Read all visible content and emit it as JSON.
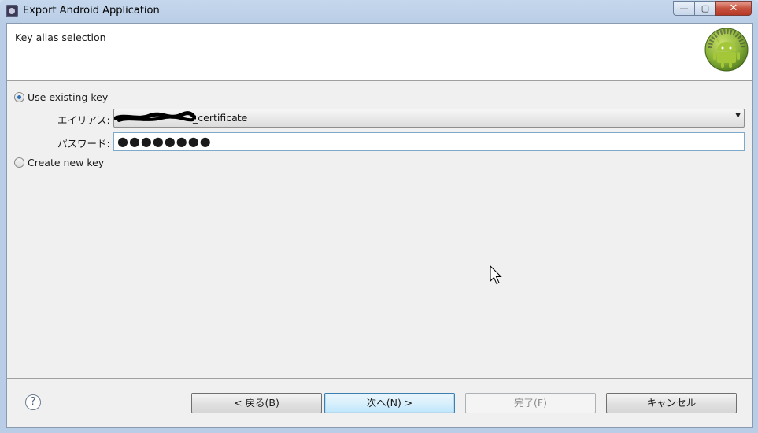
{
  "window": {
    "title": "Export Android Application",
    "controls": {
      "minimize": "—",
      "maximize": "▢",
      "close": "✕"
    }
  },
  "header": {
    "title": "Key alias selection"
  },
  "options": {
    "use_existing": "Use existing key",
    "create_new": "Create new key",
    "selected": "use_existing"
  },
  "form": {
    "alias_label": "エイリアス:",
    "alias_value": "_certificate",
    "password_label": "パスワード:",
    "password_value": "●●●●●●●●"
  },
  "footer": {
    "help": "?",
    "back": "< 戻る(B)",
    "next": "次へ(N) >",
    "finish": "完了(F)",
    "cancel": "キャンセル"
  },
  "colors": {
    "accent": "#2d6fbd",
    "focus_border": "#3c7fb1"
  },
  "icons": [
    "eclipse-app-icon",
    "android-logo-icon",
    "help-icon",
    "chevron-down-icon",
    "mouse-pointer-icon"
  ]
}
